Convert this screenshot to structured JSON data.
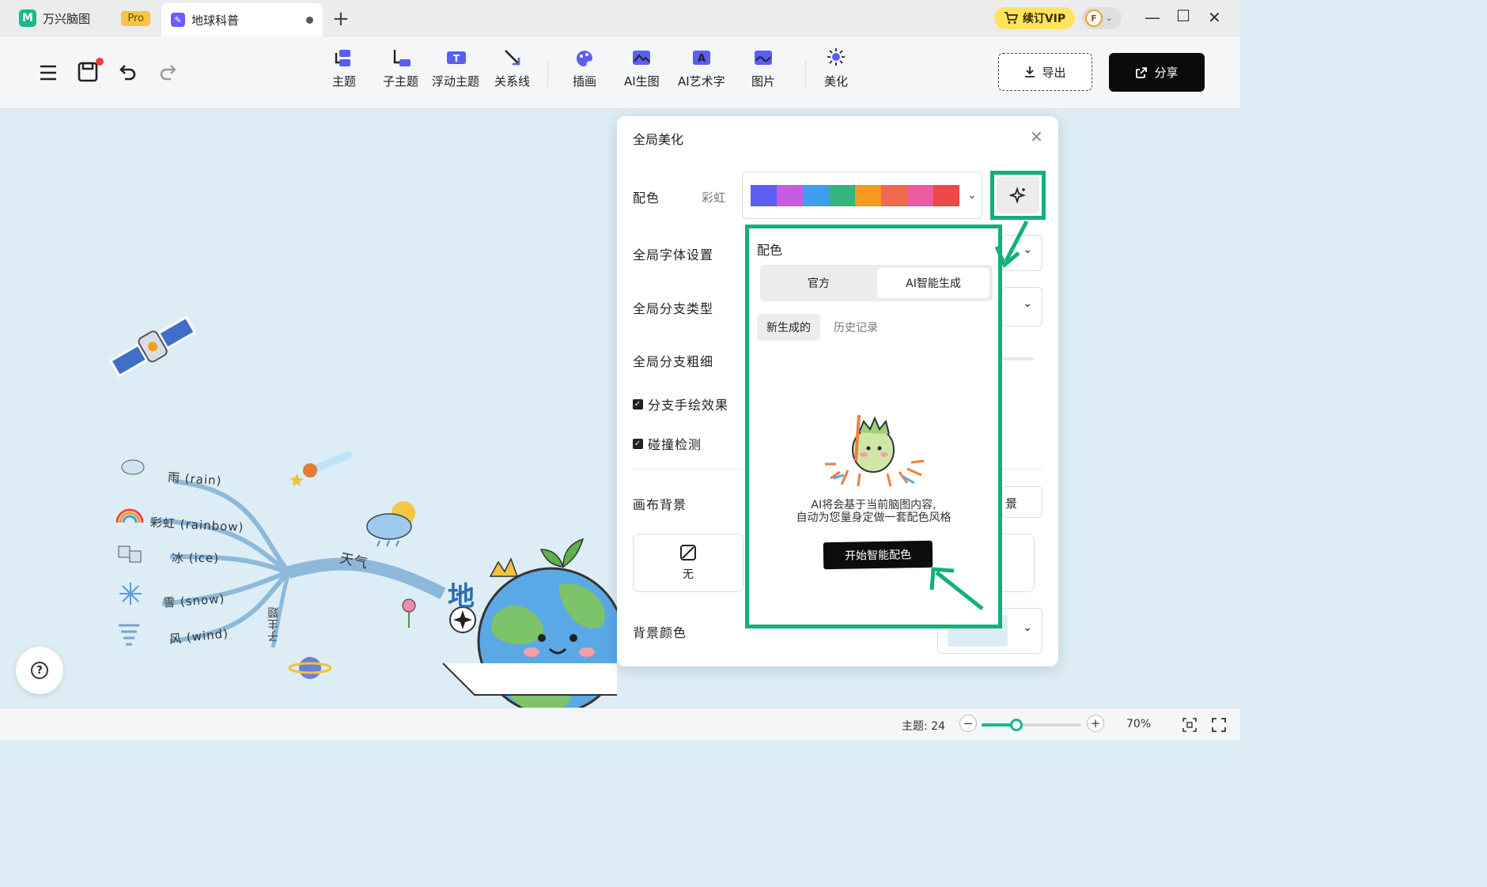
{
  "tabs": {
    "app_name": "万兴脑图",
    "pro_badge": "Pro",
    "document_name": "地球科普"
  },
  "account": {
    "vip_label": "续订VIP",
    "avatar_initial": "F"
  },
  "toolbar": {
    "tools": [
      {
        "label": "主题",
        "icon": "topic-icon"
      },
      {
        "label": "子主题",
        "icon": "subtopic-icon"
      },
      {
        "label": "浮动主题",
        "icon": "floating-topic-icon"
      },
      {
        "label": "关系线",
        "icon": "relation-line-icon"
      },
      {
        "label": "插画",
        "icon": "illustration-icon"
      },
      {
        "label": "AI生图",
        "icon": "ai-image-icon"
      },
      {
        "label": "AI艺术字",
        "icon": "ai-art-text-icon"
      },
      {
        "label": "图片",
        "icon": "image-icon"
      },
      {
        "label": "美化",
        "icon": "beautify-icon"
      }
    ],
    "export_label": "导出",
    "share_label": "分享"
  },
  "mindmap": {
    "branch_label": "天气",
    "subtopic_label": "子主题",
    "center_partial": "地",
    "nodes": [
      "雨 (rain)",
      "彩虹 (rainbow)",
      "冰 (ice)",
      "雪 (snow)",
      "风 (wind)"
    ]
  },
  "panel": {
    "title": "全局美化",
    "color_label": "配色",
    "color_scheme_name": "彩虹",
    "palette": [
      "#5b5ef5",
      "#c75ce0",
      "#3f9cf0",
      "#36b37e",
      "#f59a1c",
      "#f0684f",
      "#ec5aa0",
      "#ef4747"
    ],
    "font_label": "全局字体设置",
    "branch_type_label": "全局分支类型",
    "branch_width_label": "全局分支粗细",
    "hand_drawn_label": "分支手绘效果",
    "hand_drawn_checked": true,
    "collision_label": "碰撞检测",
    "collision_checked": true,
    "canvas_bg_label": "画布背景",
    "canvas_bg_none": "无",
    "canvas_bg_side_partial": "景",
    "bg_color_label": "背景颜色",
    "bg_color_value": "#dcedf6"
  },
  "popover": {
    "title": "配色",
    "tab_official": "官方",
    "tab_ai": "AI智能生成",
    "subtab_new": "新生成的",
    "subtab_history": "历史记录",
    "description_line1": "AI将会基于当前脑图内容,",
    "description_line2": "自动为您量身定做一套配色风格",
    "generate_button": "开始智能配色"
  },
  "status": {
    "topic_count": "主题: 24",
    "zoom": "70%",
    "zoom_fraction": 0.35
  },
  "accent_color": "#12b07a"
}
